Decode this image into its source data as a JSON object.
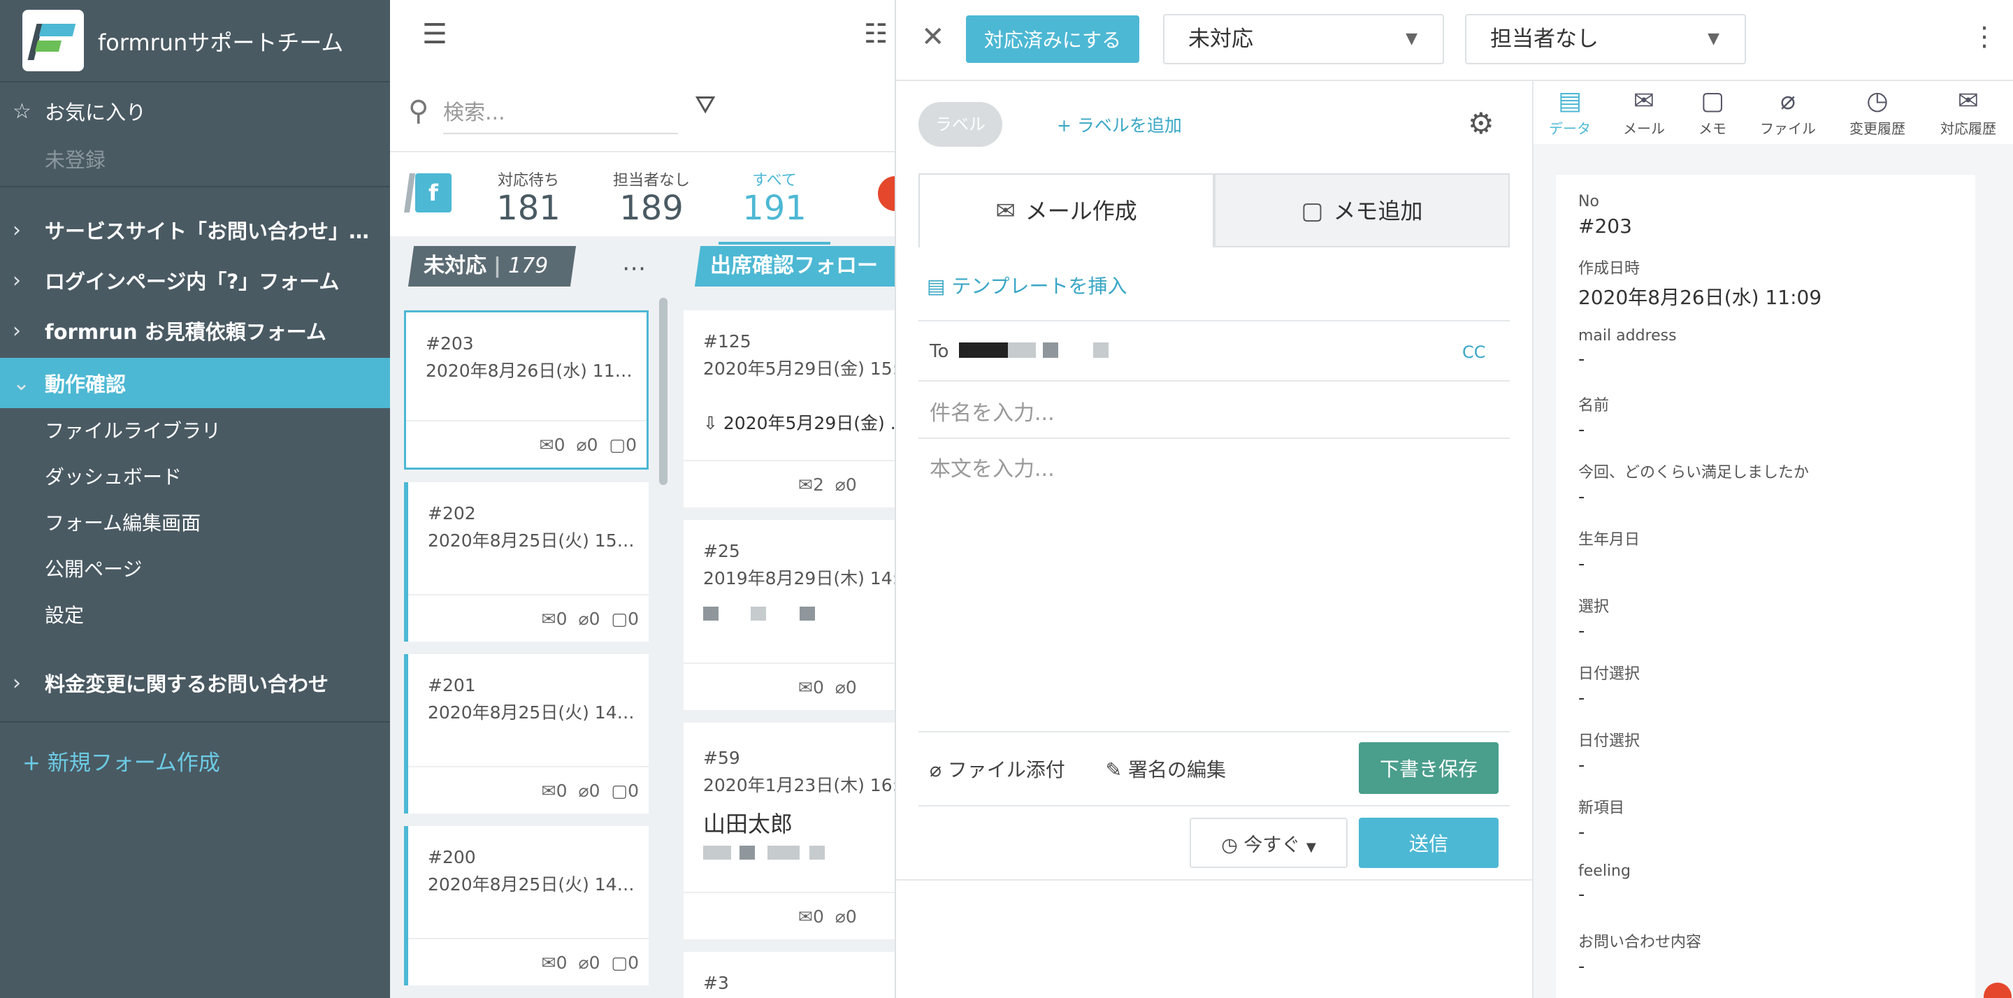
{
  "sidebar": {
    "team_name": "formrunサポートチーム",
    "favorites_label": "お気に入り",
    "unregistered_label": "未登録",
    "forms": [
      {
        "label": "サービスサイト「お問い合わせ」フ..."
      },
      {
        "label": "ログインページ内「?」フォーム"
      },
      {
        "label": "formrun お見積依頼フォーム"
      },
      {
        "label": "動作確認"
      }
    ],
    "sub_items": [
      {
        "label": "ファイルライブラリ"
      },
      {
        "label": "ダッシュボード"
      },
      {
        "label": "フォーム編集画面"
      },
      {
        "label": "公開ページ"
      },
      {
        "label": "設定"
      }
    ],
    "last_form": "料金変更に関するお問い合わせ",
    "new_form": "+ 新規フォーム作成"
  },
  "board": {
    "search_placeholder": "検索...",
    "badge_letter": "f",
    "counts": [
      {
        "label": "対応待ち",
        "value": "181"
      },
      {
        "label": "担当者なし",
        "value": "189"
      },
      {
        "label": "すべて",
        "value": "191"
      }
    ],
    "columns": [
      {
        "title": "未対応",
        "count": "179"
      },
      {
        "title": "出席確認フォロー"
      }
    ],
    "col1_cards": [
      {
        "no": "#203",
        "date": "2020年8月26日(水) 11:...",
        "mail": "0",
        "file": "0",
        "memo": "0"
      },
      {
        "no": "#202",
        "date": "2020年8月25日(火) 15:...",
        "mail": "0",
        "file": "0",
        "memo": "0"
      },
      {
        "no": "#201",
        "date": "2020年8月25日(火) 14:...",
        "mail": "0",
        "file": "0",
        "memo": "0"
      },
      {
        "no": "#200",
        "date": "2020年8月25日(火) 14:...",
        "mail": "0",
        "file": "0",
        "memo": "0"
      }
    ],
    "col2_cards": [
      {
        "no": "#125",
        "date": "2020年5月29日(金) 15:...",
        "extra": "2020年5月29日(金) ...",
        "mail": "2",
        "file": "0"
      },
      {
        "no": "#25",
        "date": "2019年8月29日(木) 14:...",
        "mail": "0",
        "file": "0"
      },
      {
        "no": "#59",
        "date": "2020年1月23日(木) 16:...",
        "name": "山田太郎",
        "mail": "0",
        "file": "0"
      },
      {
        "no": "#3"
      }
    ]
  },
  "panel": {
    "done_button": "対応済みにする",
    "status_select": "未対応",
    "assignee_select": "担当者なし",
    "label_pill": "ラベル",
    "add_label": "+ ラベルを追加",
    "tab_mail": "メール作成",
    "tab_memo": "メモ追加",
    "insert_template": "テンプレートを挿入",
    "to_label": "To",
    "cc_label": "CC",
    "subject_placeholder": "件名を入力...",
    "body_placeholder": "本文を入力...",
    "attach_file": "ファイル添付",
    "edit_signature": "署名の編集",
    "save_draft": "下書き保存",
    "send_when": "今すぐ",
    "send": "送信"
  },
  "detail": {
    "tabs": [
      {
        "label": "データ",
        "icon": "document-icon"
      },
      {
        "label": "メール",
        "icon": "mail-icon"
      },
      {
        "label": "メモ",
        "icon": "memo-icon"
      },
      {
        "label": "ファイル",
        "icon": "paperclip-icon"
      },
      {
        "label": "変更履歴",
        "icon": "clock-icon"
      },
      {
        "label": "対応履歴",
        "icon": "mail-clock-icon"
      }
    ],
    "fields": [
      {
        "key": "No",
        "value": "#203"
      },
      {
        "key": "作成日時",
        "value": "2020年8月26日(水) 11:09"
      },
      {
        "key": "mail address",
        "value": "-"
      },
      {
        "key": "名前",
        "value": "-"
      },
      {
        "key": "今回、どのくらい満足しましたか",
        "value": "-"
      },
      {
        "key": "生年月日",
        "value": "-"
      },
      {
        "key": "選択",
        "value": "-"
      },
      {
        "key": "日付選択",
        "value": "-"
      },
      {
        "key": "日付選択",
        "value": "-"
      },
      {
        "key": "新項目",
        "value": "-"
      },
      {
        "key": "feeling",
        "value": "-"
      },
      {
        "key": "お問い合わせ内容",
        "value": "-"
      }
    ]
  },
  "colors": {
    "accent": "#4db8d4",
    "sidebar": "#4a5a63",
    "draft": "#4a9e8c"
  }
}
